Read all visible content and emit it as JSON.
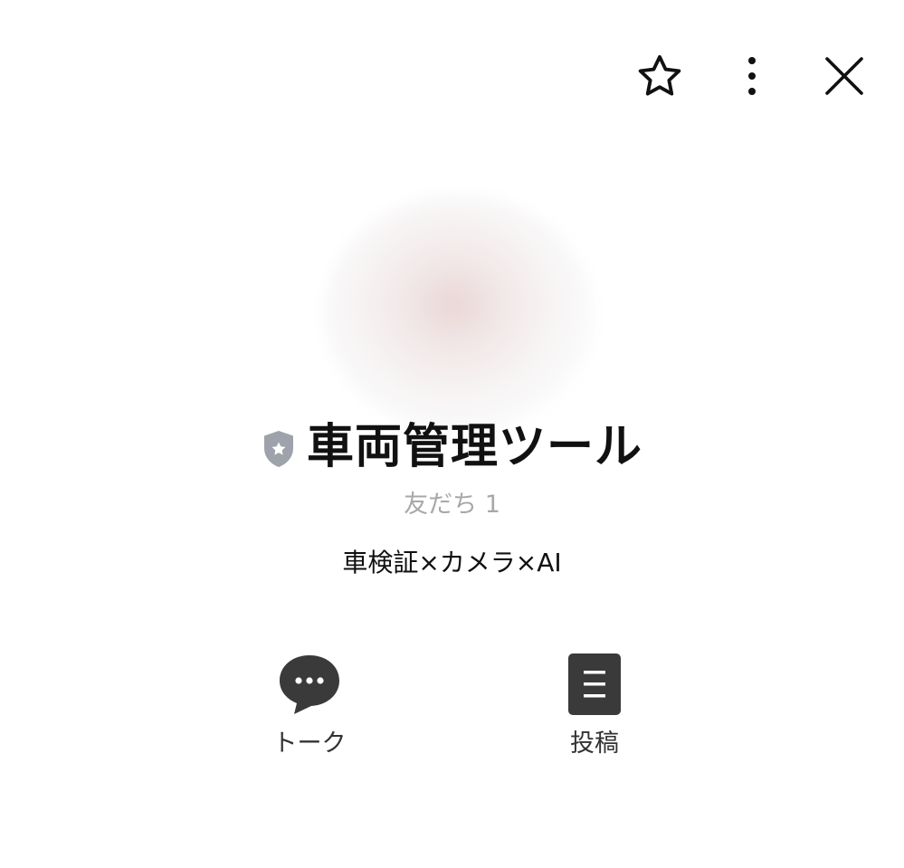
{
  "header": {
    "favorite_icon": "star-outline-icon",
    "menu_icon": "more-vertical-icon",
    "close_icon": "close-icon"
  },
  "profile": {
    "name": "車両管理ツール",
    "badge_icon": "shield-star-icon",
    "friends_label": "友だち 1",
    "status_message": "車検証×カメラ×AI"
  },
  "actions": {
    "talk": {
      "label": "トーク",
      "icon": "chat-bubble-icon"
    },
    "post": {
      "label": "投稿",
      "icon": "document-icon"
    }
  },
  "colors": {
    "text": "#111111",
    "muted": "#a8a8a8",
    "icon_dark": "#3a3a3a",
    "badge_gray": "#9ea2aa"
  }
}
